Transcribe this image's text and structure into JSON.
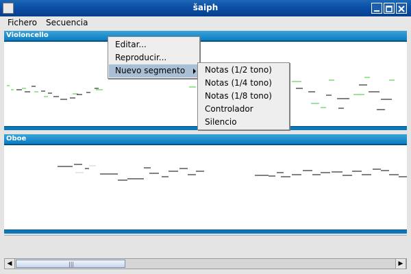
{
  "window": {
    "title": "šaiph"
  },
  "menubar": {
    "items": [
      "Fichero",
      "Secuencia"
    ]
  },
  "tracks": [
    {
      "name": "Violoncello"
    },
    {
      "name": "Oboe"
    }
  ],
  "context_menu": {
    "items": [
      "Editar...",
      "Reproducir...",
      "Nuevo segmento"
    ],
    "selected": "Nuevo segmento",
    "submenu": [
      "Notas (1/2 tono)",
      "Notas (1/4 tono)",
      "Notas (1/8 tono)",
      "Controlador",
      "Silencio"
    ]
  },
  "colors": {
    "accent": "#0b7dc1",
    "note_black": "#000000",
    "note_green": "#33cc33",
    "selection": "#a9bfd6"
  }
}
